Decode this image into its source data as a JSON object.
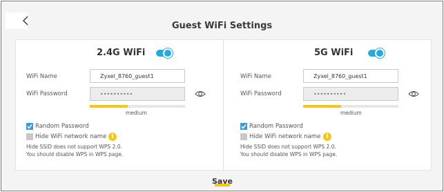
{
  "page": {
    "title": "Guest WiFi Settings",
    "save_label": "Save"
  },
  "bands": [
    {
      "title": "2.4G WiFi",
      "enabled": true,
      "wifi_name_label": "WiFi Name",
      "wifi_name_value": "Zyxel_8760_guest1",
      "wifi_password_label": "WiFi Password",
      "wifi_password_value": "••••••••••",
      "strength_text": "medium",
      "strength_fill": 0.4,
      "random_password_label": "Random Password",
      "random_password_checked": true,
      "hide_name_label": "Hide WiFi network name",
      "hide_name_checked": false,
      "note_line1": "Hide SSID does not support WPS 2.0.",
      "note_line2": "You should disable WPS in WPS page."
    },
    {
      "title": "5G WiFi",
      "enabled": true,
      "wifi_name_label": "WiFi Name",
      "wifi_name_value": "Zyxel_8760_guest1",
      "wifi_password_label": "WiFi Password",
      "wifi_password_value": "••••••••••",
      "strength_text": "medium",
      "strength_fill": 0.4,
      "random_password_label": "Random Password",
      "random_password_checked": true,
      "hide_name_label": "Hide WiFi network name",
      "hide_name_checked": false,
      "note_line1": "Hide SSID does not support WPS 2.0.",
      "note_line2": "You should disable WPS in WPS page."
    }
  ],
  "colors": {
    "accent_blue": "#29a8e0",
    "accent_yellow": "#f4c51b"
  }
}
